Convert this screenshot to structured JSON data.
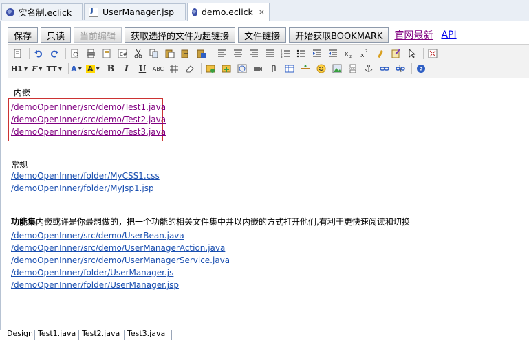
{
  "tabs": [
    {
      "label": "实名制.eclick",
      "icon": "eclipse-icon"
    },
    {
      "label": "UserManager.jsp",
      "icon": "jsp-icon"
    },
    {
      "label": "demo.eclick",
      "icon": "eclipse-icon",
      "active": true,
      "close": "×"
    }
  ],
  "buttons": {
    "save": "保存",
    "readonly": "只读",
    "edit": "当前编辑",
    "hyperlink": "获取选择的文件为超链接",
    "filelink": "文件链接",
    "bookmark": "开始获取BOOKMARK"
  },
  "links": {
    "official": "官网最新",
    "api": "API"
  },
  "toolbar": {
    "heading": "H1",
    "font": "F",
    "size": "TT",
    "fontcolor": "A",
    "bgcolor": "A",
    "bold": "B",
    "italic": "I",
    "underline": "U",
    "strike": "ABC"
  },
  "content": {
    "section1_title": "内嵌",
    "section1_links": [
      "/demoOpenInner/src/demo/Test1.java",
      "/demoOpenInner/src/demo/Test2.java",
      "/demoOpenInner/src/demo/Test3.java"
    ],
    "section2_title": "常规",
    "section2_links": [
      "/demoOpenInner/folder/MyCSS1.css",
      "/demoOpenInner/folder/MyJsp1.jsp"
    ],
    "section3_bold": "功能集",
    "section3_text": "内嵌或许是你最想做的，把一个功能的相关文件集中并以内嵌的方式打开他们,有利于更快速阅读和切换",
    "section3_links": [
      "/demoOpenInner/src/demo/UserBean.java",
      "/demoOpenInner/src/demo/UserManagerAction.java",
      "/demoOpenInner/src/demo/UserManagerService.java",
      "/demoOpenInner/folder/UserManager.js",
      "/demoOpenInner/folder/UserManager.jsp"
    ]
  },
  "bottom_tabs": [
    "Design",
    "Test1.java",
    "Test2.java",
    "Test3.java"
  ]
}
